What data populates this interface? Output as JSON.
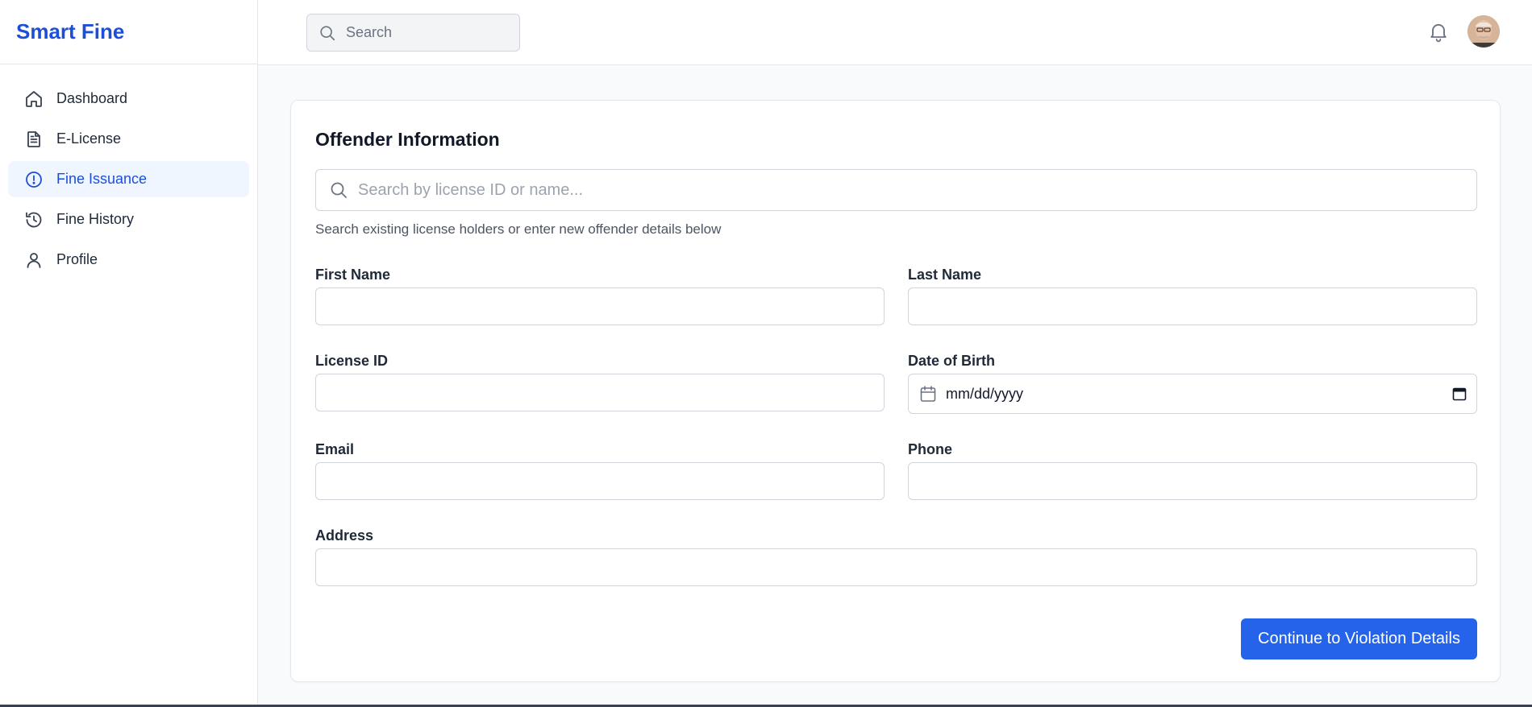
{
  "brand": "Smart Fine",
  "sidebar": {
    "items": [
      {
        "label": "Dashboard",
        "icon": "home-icon",
        "active": false
      },
      {
        "label": "E-License",
        "icon": "document-icon",
        "active": false
      },
      {
        "label": "Fine Issuance",
        "icon": "alert-circle-icon",
        "active": true
      },
      {
        "label": "Fine History",
        "icon": "history-icon",
        "active": false
      },
      {
        "label": "Profile",
        "icon": "user-icon",
        "active": false
      }
    ]
  },
  "header": {
    "search_placeholder": "Search"
  },
  "form": {
    "title": "Offender Information",
    "search_placeholder": "Search by license ID or name...",
    "hint": "Search existing license holders or enter new offender details below",
    "first_name_label": "First Name",
    "last_name_label": "Last Name",
    "license_id_label": "License ID",
    "dob_label": "Date of Birth",
    "dob_placeholder": "mm/dd/yyyy",
    "email_label": "Email",
    "phone_label": "Phone",
    "address_label": "Address",
    "continue_label": "Continue to Violation Details"
  },
  "colors": {
    "accent": "#2563eb",
    "brand": "#1d4ed8",
    "active_bg": "#eff6ff"
  }
}
